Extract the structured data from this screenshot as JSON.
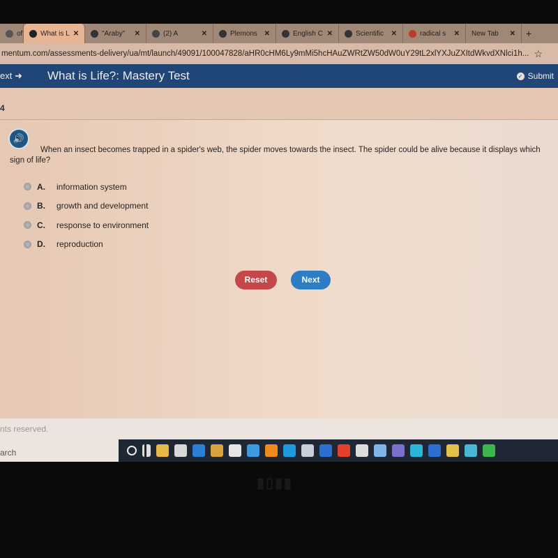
{
  "browser": {
    "tabs": [
      {
        "label": "oft",
        "icon": "generic-icon",
        "color": "#555555"
      },
      {
        "label": "What is L",
        "icon": "edmentum-icon",
        "color": "#222222",
        "active": true
      },
      {
        "label": "\"Araby\"",
        "icon": "globe-icon",
        "color": "#333333"
      },
      {
        "label": "(2) A",
        "icon": "teams-icon",
        "color": "#444444"
      },
      {
        "label": "Plemons",
        "icon": "contact-icon",
        "color": "#333333"
      },
      {
        "label": "English C",
        "icon": "w-icon",
        "color": "#333333"
      },
      {
        "label": "Scientific",
        "icon": "globe-icon",
        "color": "#333333"
      },
      {
        "label": "radical s",
        "icon": "google-icon",
        "color": "#c0392b"
      },
      {
        "label": "New Tab",
        "icon": "",
        "color": ""
      }
    ],
    "new_tab_label": "+",
    "url": "mentum.com/assessments-delivery/ua/mt/launch/49091/100047828/aHR0cHM6Ly9mMi5hcHAuZWRtZW50dW0uY29tL2xlYXJuZXItdWkvdXNlci1h..."
  },
  "header": {
    "next_label": "ext",
    "title": "What is Life?: Mastery Test",
    "submit_label": "Submit",
    "color": "#1f4676"
  },
  "question": {
    "number": "4",
    "text": "When an insect becomes trapped in a spider's web, the spider moves towards the insect. The spider could be alive because it displays which sign  of life?",
    "options": [
      {
        "letter": "A.",
        "text": "information system"
      },
      {
        "letter": "B.",
        "text": "growth and development"
      },
      {
        "letter": "C.",
        "text": "response to environment"
      },
      {
        "letter": "D.",
        "text": "reproduction"
      }
    ]
  },
  "buttons": {
    "reset": "Reset",
    "next": "Next",
    "reset_color": "#c4474a",
    "next_color": "#2c7cc6"
  },
  "footer": {
    "rights": "nts reserved.",
    "search": "arch"
  },
  "taskbar": [
    {
      "name": "cortana-icon",
      "color": "#1e2733"
    },
    {
      "name": "task-view-icon",
      "color": "#1e2733"
    },
    {
      "name": "file-explorer-icon",
      "color": "#e8b94a"
    },
    {
      "name": "store-icon",
      "color": "#d8d8d8"
    },
    {
      "name": "edge-icon",
      "color": "#2b7fd4"
    },
    {
      "name": "chrome-icon",
      "color": "#d9a23a"
    },
    {
      "name": "camera-icon",
      "color": "#e5e5e5"
    },
    {
      "name": "mail-icon",
      "color": "#3d9ae0"
    },
    {
      "name": "vlc-icon",
      "color": "#f08a1c"
    },
    {
      "name": "skype-icon",
      "color": "#1e9be0"
    },
    {
      "name": "paint-icon",
      "color": "#c8cfd8"
    },
    {
      "name": "word-icon",
      "color": "#2c6fd0"
    },
    {
      "name": "office-icon",
      "color": "#e2412b"
    },
    {
      "name": "calendar-icon",
      "color": "#dcdcdc"
    },
    {
      "name": "network-icon",
      "color": "#7eb4e8"
    },
    {
      "name": "teams-icon",
      "color": "#7b6fd0"
    },
    {
      "name": "globe-icon",
      "color": "#2bb6d8"
    },
    {
      "name": "word-doc-icon",
      "color": "#2c6fd0"
    },
    {
      "name": "shield-icon",
      "color": "#e0c24a"
    },
    {
      "name": "app-icon",
      "color": "#4ab6d8"
    },
    {
      "name": "green-app-icon",
      "color": "#3cb54a"
    }
  ],
  "bezel_logo": "DELL"
}
